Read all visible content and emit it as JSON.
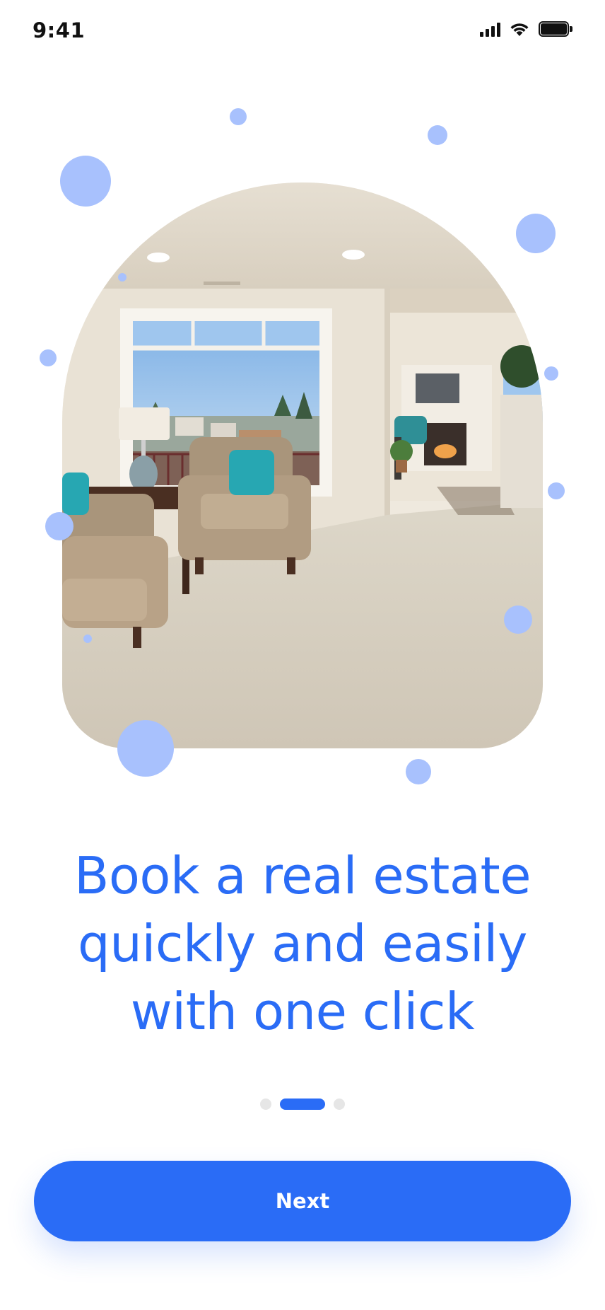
{
  "status_bar": {
    "time": "9:41",
    "icons": [
      "cellular-signal-icon",
      "wifi-icon",
      "battery-icon"
    ]
  },
  "onboarding": {
    "image": "living-room-photo",
    "title_lines": [
      "Book a real estate",
      "quickly and easily",
      "with one click"
    ],
    "pager": {
      "total": 3,
      "active_index": 1
    },
    "next_label": "Next"
  },
  "colors": {
    "accent": "#2a6cf6",
    "bubble": "#a8c1fd",
    "inactive_dot": "#e6e6e6"
  }
}
